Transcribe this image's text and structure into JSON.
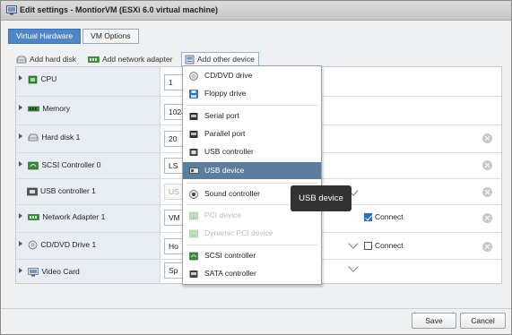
{
  "window": {
    "title": "Edit settings - MontiorVM (ESXi 6.0 virtual machine)"
  },
  "tabs": [
    {
      "label": "Virtual Hardware",
      "active": true
    },
    {
      "label": "VM Options",
      "active": false
    }
  ],
  "toolbar": {
    "add_hard_disk": "Add hard disk",
    "add_network_adapter": "Add network adapter",
    "add_other_device": "Add other device"
  },
  "hardware": {
    "cpu": {
      "label": "CPU",
      "value": "1"
    },
    "memory": {
      "label": "Memory",
      "value": "1024"
    },
    "hard_disk": {
      "label": "Hard disk 1",
      "value": "20"
    },
    "scsi": {
      "label": "SCSI Controller 0",
      "value": "LS"
    },
    "usb": {
      "label": "USB controller 1",
      "value": "US"
    },
    "network": {
      "label": "Network Adapter 1",
      "value": "VM",
      "connect_label": "Connect",
      "connect_checked": true
    },
    "cdrom": {
      "label": "CD/DVD Drive 1",
      "value": "Ho",
      "connect_label": "Connect",
      "connect_checked": false
    },
    "video": {
      "label": "Video Card",
      "value": "Sp"
    }
  },
  "menu": {
    "items": [
      {
        "label": "CD/DVD drive",
        "icon": "cd-icon",
        "state": "normal"
      },
      {
        "label": "Floppy drive",
        "icon": "floppy-icon",
        "state": "normal"
      },
      {
        "label": "Serial port",
        "icon": "serial-port-icon",
        "state": "normal"
      },
      {
        "label": "Parallel port",
        "icon": "parallel-port-icon",
        "state": "normal"
      },
      {
        "label": "USB controller",
        "icon": "usb-controller-icon",
        "state": "normal"
      },
      {
        "label": "USB device",
        "icon": "usb-device-icon",
        "state": "highlighted"
      },
      {
        "label": "Sound controller",
        "icon": "sound-icon",
        "state": "normal"
      },
      {
        "label": "PCI device",
        "icon": "pci-icon",
        "state": "disabled"
      },
      {
        "label": "Dynamic PCI device",
        "icon": "dynamic-pci-icon",
        "state": "disabled"
      },
      {
        "label": "SCSI controller",
        "icon": "scsi-icon",
        "state": "normal"
      },
      {
        "label": "SATA controller",
        "icon": "sata-icon",
        "state": "normal"
      }
    ]
  },
  "tooltip": {
    "text": "USB device"
  },
  "footer": {
    "save": "Save",
    "cancel": "Cancel"
  },
  "colors": {
    "accent": "#4f86c8",
    "highlight": "#5d7d9e",
    "tooltip_bg": "#333333"
  }
}
